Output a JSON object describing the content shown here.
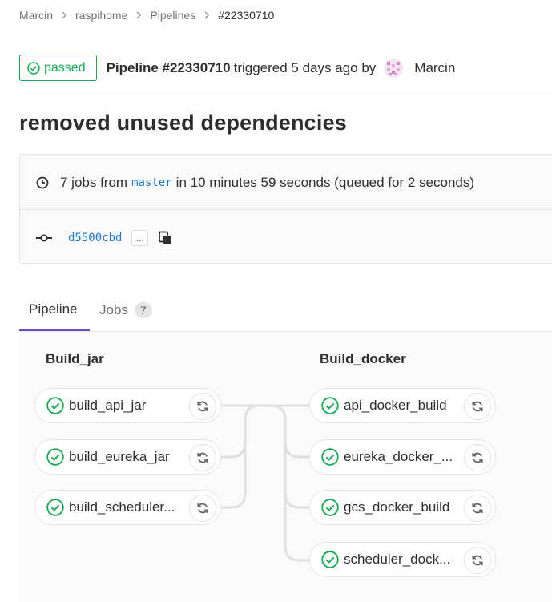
{
  "breadcrumb": [
    "Marcin",
    "raspihome",
    "Pipelines",
    "#22330710"
  ],
  "header": {
    "status": "passed",
    "pipeline_label": "Pipeline #22330710",
    "triggered_text": "triggered 5 days ago by",
    "author": "Marcin"
  },
  "commit_title": "removed unused dependencies",
  "info": {
    "jobs_prefix": "7 jobs from",
    "branch": "master",
    "duration_text": "in 10 minutes 59 seconds (queued for 2 seconds)",
    "commit_sha": "d5500cbd",
    "ellipsis": "..."
  },
  "tabs": {
    "pipeline": "Pipeline",
    "jobs": "Jobs",
    "jobs_count": "7"
  },
  "stages": [
    {
      "title": "Build_jar",
      "jobs": [
        "build_api_jar",
        "build_eureka_jar",
        "build_scheduler..."
      ]
    },
    {
      "title": "Build_docker",
      "jobs": [
        "api_docker_build",
        "eureka_docker_...",
        "gcs_docker_build",
        "scheduler_dock..."
      ]
    }
  ],
  "colors": {
    "success": "#1aaa55",
    "link": "#1f78d1",
    "active_tab": "#6b4fbb"
  }
}
